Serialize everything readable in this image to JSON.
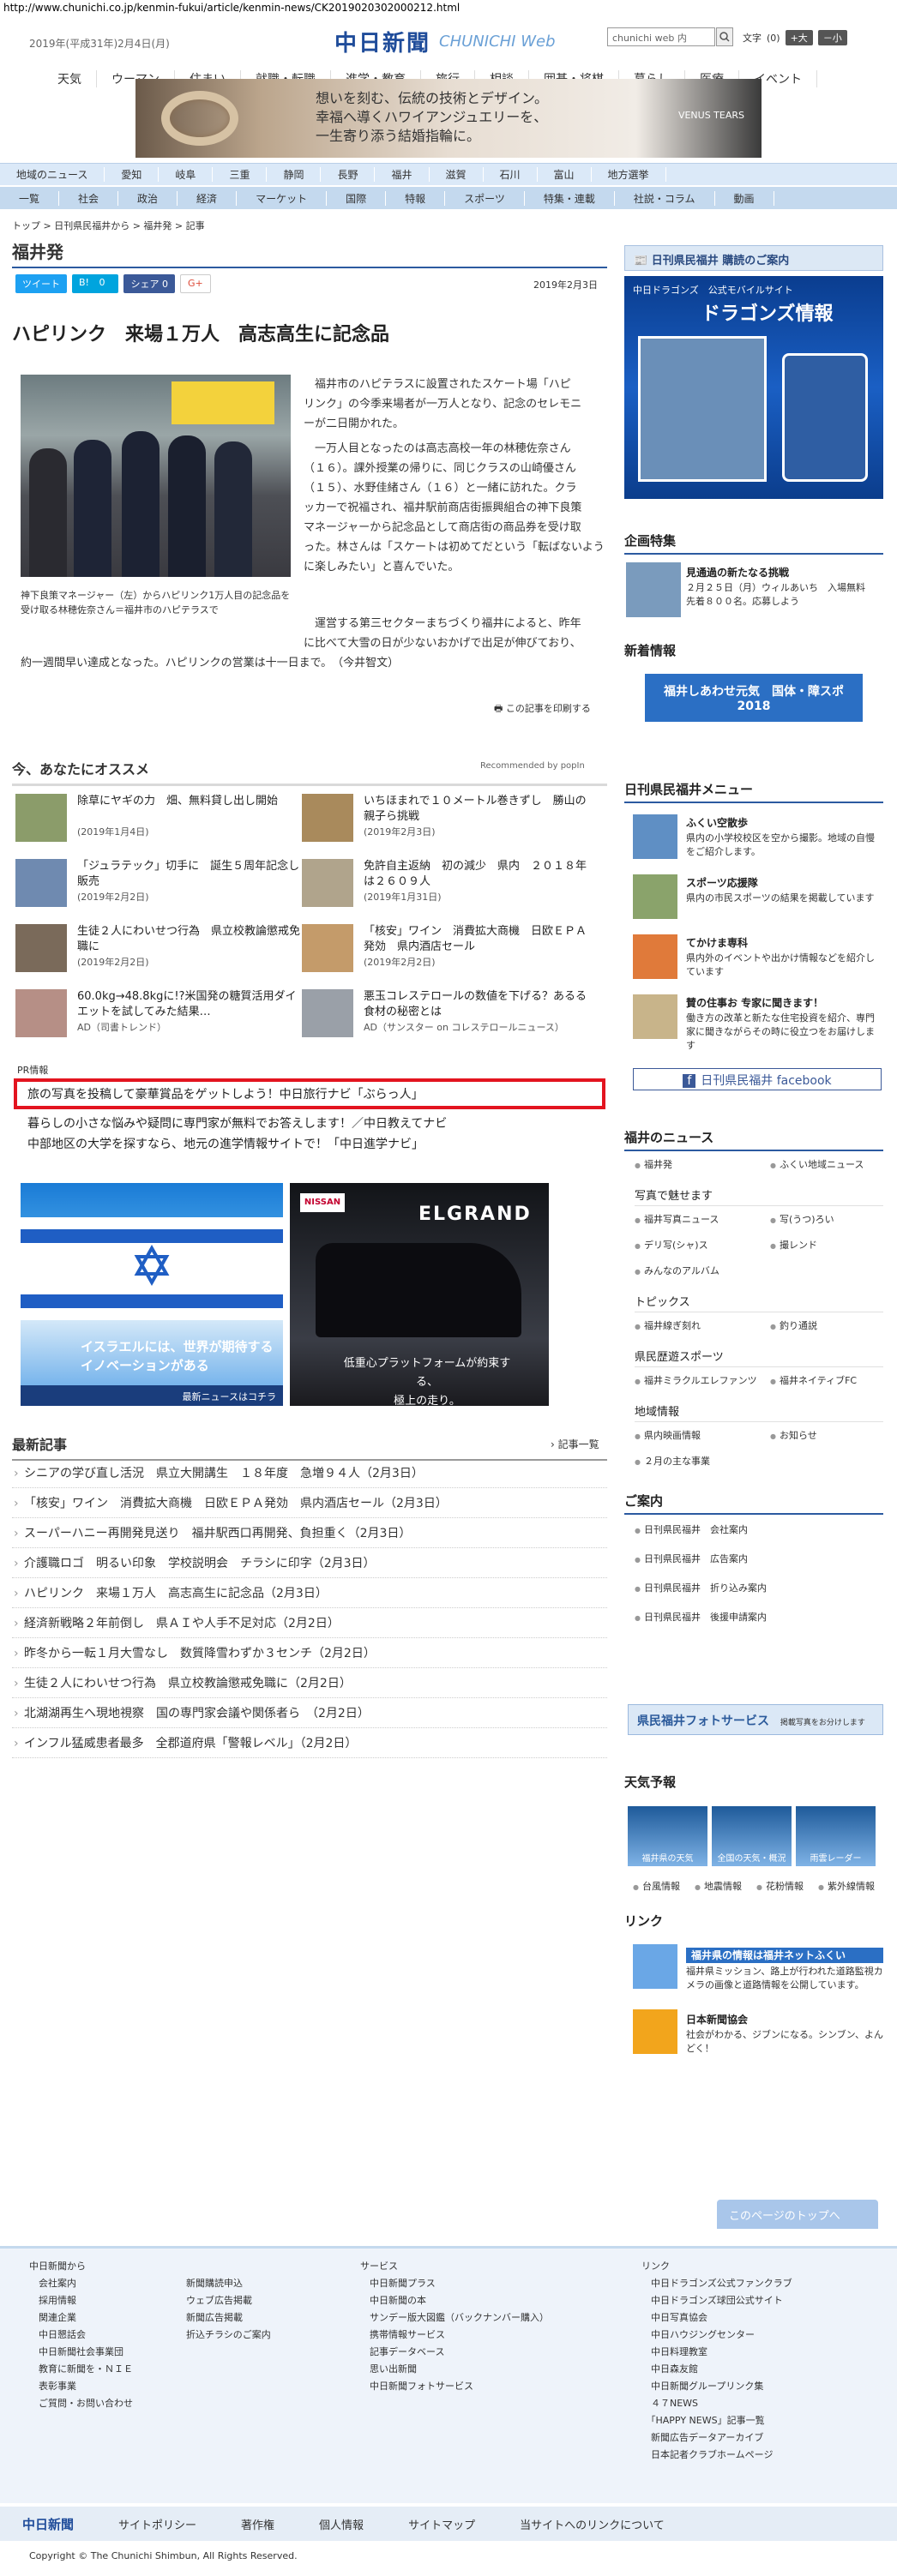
{
  "url": "http://www.chunichi.co.jp/kenmin-fukui/article/kenmin-news/CK2019020302000212.html",
  "header": {
    "date": "2019年(平成31年)2月4日(月)",
    "logo_jp": "中日新聞",
    "logo_en": "CHUNICHI Web",
    "search_placeholder": "chunichi web 内",
    "fontsize_label": "文字",
    "fontsize_value": "(0)",
    "fontsize_up": "+大",
    "fontsize_down": "－小"
  },
  "topnav": [
    "天気",
    "ウーマン",
    "住まい",
    "就職・転職",
    "進学・教育",
    "旅行",
    "相談",
    "囲碁・将棋",
    "暮らし",
    "医療",
    "イベント"
  ],
  "banner": {
    "line1": "想いを刻む、伝統の技術とデザイン。",
    "line2": "幸福へ導くハワイアンジュエリーを、",
    "line3": "一生寄り添う結婚指輪に。",
    "brand": "VENUS TEARS"
  },
  "regionbar": [
    "地域のニュース",
    "愛知",
    "岐阜",
    "三重",
    "静岡",
    "長野",
    "福井",
    "滋賀",
    "石川",
    "富山",
    "地方選挙"
  ],
  "catbar": [
    "一覧",
    "社会",
    "政治",
    "経済",
    "マーケット",
    "国際",
    "特報",
    "スポーツ",
    "特集・連載",
    "社説・コラム",
    "動画"
  ],
  "breadcrumb": "トップ > 日刊県民福井から > 福井発 > 記事",
  "section_title": "福井発",
  "social": {
    "tweet": "ツイート",
    "hatena": "0",
    "share": "シェア 0",
    "gplus": "G+"
  },
  "pubdate": "2019年2月3日",
  "headline": "ハピリンク　来場１万人　高志高生に記念品",
  "photo_caption": "神下良策マネージャー（左）からハピリンク1万人目の記念品を受け取る林穂佐奈さん＝福井市のハピテラスで",
  "body": {
    "p1a": "福井市のハピテラスに設置されたスケート場「ハピ",
    "p1b": "リンク」の今季来場者が一万人となり、記念のセレモニ",
    "p1c": "ーが二日開かれた。",
    "p2a": "一万人目となったのは高志高校一年の林穂佐奈さん",
    "p2b": "（１６）。課外授業の帰りに、同じクラスの山崎優さん",
    "p2c": "（１５）、水野佳緒さん（１６）と一緒に訪れた。クラ",
    "p2d": "ッカーで祝福され、福井駅前商店街振興組合の神下良策",
    "p2e": "マネージャーから記念品として商店街の商品券を受け取",
    "p2f": "った。林さんは「スケートは初めてだという「転ばないよう",
    "p2g": "に楽しみたい」と喜んでいた。",
    "p3a": "運営する第三セクターまちづくり福井によると、昨年",
    "p3b": "に比べて大雪の日が少ないおかげで出足が伸びており、",
    "p3c": "約一週間早い達成となった。ハピリンクの営業は十一日まで。　（今井智文）"
  },
  "print_label": "この記事を印刷する",
  "recommend": {
    "title": "今、あなたにオススメ",
    "by": "Recommended by popIn",
    "items": [
      {
        "title": "除草にヤギの力　畑、無料貸し出し開始",
        "date": "(2019年1月4日)"
      },
      {
        "title": "いちほまれで１０メートル巻きずし　勝山の親子ら挑戦",
        "date": "(2019年2月3日)"
      },
      {
        "title": "「ジュラテック」切手に　誕生５周年記念し販売",
        "date": "(2019年2月2日)"
      },
      {
        "title": "免許自主返納　初の減少　県内　２０１８年は２６０９人",
        "date": "(2019年1月31日)"
      },
      {
        "title": "生徒２人にわいせつ行為　県立校教論懲戒免職に",
        "date": "(2019年2月2日)"
      },
      {
        "title": "「核安」ワイン　消費拡大商機　日欧ＥＰＡ発効　県内酒店セール",
        "date": "(2019年2月2日)"
      },
      {
        "title": "60.0kg→48.8kgに!?米国発の糖質活用ダイエットを試してみた結果…",
        "date": "AD（司書トレンド）"
      },
      {
        "title": "悪玉コレステロールの数値を下げる？あるる食材の秘密とは",
        "date": "AD（サンスター on コレステロールニュース）"
      }
    ]
  },
  "pr": {
    "label": "PR情報",
    "l1": "旅の写真を投稿して豪華賞品をゲットしよう！中日旅行ナビ「ぶらっ人」",
    "l2": "暮らしの小さな悩みや疑問に専門家が無料でお答えします！／中日教えてナビ",
    "l3": "中部地区の大学を探すなら、地元の進学情報サイトで！「中日進学ナビ」"
  },
  "ads": {
    "a1_text": "イスラエルには、世界が期待するイノベーションがある",
    "a1_foot": "最新ニュースはコチラ",
    "a2_brand": "NISSAN",
    "a2_model": "ELGRAND",
    "a2_text1": "低重心プラットフォームが約束する、",
    "a2_text2": "極上の走り。"
  },
  "latest": {
    "title": "最新記事",
    "more": "記事一覧",
    "items": [
      "シニアの学び直し活況　県立大開講生　１８年度　急増９４人（2月3日）",
      "「核安」ワイン　消費拡大商機　日欧ＥＰＡ発効　県内酒店セール（2月3日）",
      "スーパーハニー再開発見送り　福井駅西口再開発、負担重く（2月3日）",
      "介護職ロゴ　明るい印象　学校説明会　チラシに印字（2月3日）",
      "ハピリンク　来場１万人　高志高生に記念品（2月3日）",
      "経済新戦略２年前倒し　県ＡＩや人手不足対応（2月2日）",
      "昨冬から一転１月大雪なし　数質降雪わずか３センチ（2月2日）",
      "生徒２人にわいせつ行為　県立校教論懲戒免職に（2月2日）",
      "北湖湖再生へ現地視察　国の専門家会議や関係者ら　（2月2日）",
      "インフル猛威患者最多　全郡道府県「警報レベル」（2月2日）"
    ]
  },
  "sidebar": {
    "subscribe": "日刊県民福井 購読のご案内",
    "dragons_title": "中日ドラゴンズ　公式モバイルサイト",
    "dragons_name": "ドラゴンズ情報",
    "kikaku_title": "企画特集",
    "kikaku_item_title": "見通過の新たなる挑戦",
    "kikaku_item_text": "２月２５日（月）ウィルあいち　入場無料　先着８００名。応募しよう",
    "new_title": "新着情報",
    "new_banner": "福井しあわせ元気　国体・障スポ 2018",
    "menu_title": "日刊県民福井メニュー",
    "menu": [
      {
        "title": "ふくい空散歩",
        "text": "県内の小学校校区を空から撮影。地域の自慢をご紹介します。"
      },
      {
        "title": "スポーツ応援隊",
        "text": "県内の市民スポーツの結果を掲載しています"
      },
      {
        "title": "てかけま専科",
        "text": "県内外のイベントや出かけ情報などを紹介しています"
      },
      {
        "title": "賛の住事お 专家に聞きます！",
        "text": "働き方の改革と新たな住宅投資を紹介、専門家に聞きながらその時に役立つをお届けします"
      }
    ],
    "facebook": "日刊県民福井 facebook",
    "fukui_news_title": "福井のニュース",
    "fukui_news": [
      "福井発",
      "ふくい地域ニュース"
    ],
    "photo_title": "写真で魅せます",
    "photo_links": [
      "福井写真ニュース",
      "写(うつ)ろい",
      "デリ写(シャ)ス",
      "撮レンド",
      "みんなのアルバム"
    ],
    "topics_title": "トピックス",
    "topics": [
      "福井線ぎ刻れ",
      "釣り通説"
    ],
    "sports_title": "県民歴遊スポーツ",
    "sports": [
      "福井ミラクルエレファンツ",
      "福井ネイティブFC"
    ],
    "local_title": "地域情報",
    "local": [
      "県内映画情報",
      "お知らせ",
      "２月の主な事業"
    ],
    "guide_title": "ご案内",
    "guide": [
      "日刊県民福井　会社案内",
      "日刊県民福井　広告案内",
      "日刊県民福井　折り込み案内",
      "日刊県民福井　後援申請案内"
    ],
    "photo_service": "県民福井フォトサービス",
    "photo_service_sub": "掲載写真をお分けします",
    "weather_title": "天気予報",
    "weather": [
      "福井県の天気",
      "全国の天気・概況",
      "雨雲レーダー"
    ],
    "weather_links": [
      "台風情報",
      "地震情報",
      "花粉情報",
      "紫外線情報"
    ],
    "links_title": "リンク",
    "link1": "福井県の情報は福井ネットふくい",
    "link1_text": "福井県ミッション、路上が行われた道路監視カメラの画像と道路情報を公開しています。",
    "link2": "日本新聞協会",
    "link2_text": "社会がわかる、ジブンになる。シンブン、よんどく！"
  },
  "totop": "このページのトップへ",
  "footer": {
    "col1_title": "中日新聞から",
    "col1": [
      "会社案内",
      "採用情報",
      "関連企業",
      "中日懇話会",
      "中日新聞社会事業団",
      "教育に新聞を・ＮＩＥ",
      "表彰事業",
      "ご質問・お問い合わせ"
    ],
    "col2": [
      "新聞購読申込",
      "ウェブ広告掲載",
      "新聞広告掲載",
      "折込チラシのご案内"
    ],
    "col3_title": "サービス",
    "col3": [
      "中日新聞プラス",
      "中日新聞の本",
      "サンデー版大図鑑（バックナンバー購入）",
      "携帯情報サービス",
      "記事データベース",
      "思い出新聞",
      "中日新聞フォトサービス"
    ],
    "col4_title": "リンク",
    "col4": [
      "中日ドラゴンズ公式ファンクラブ",
      "中日ドラゴンズ球団公式サイト",
      "中日写真協会",
      "中日ハウジングセンター",
      "中日料理教室",
      "中日森友館",
      "中日新聞グループリンク集",
      "４７NEWS",
      "「HAPPY NEWS」記事一覧",
      "新聞広告データアーカイブ",
      "日本記者クラブホームページ"
    ],
    "bar": [
      "中日新聞",
      "サイトポリシー",
      "著作権",
      "個人情報",
      "サイトマップ",
      "当サイトへのリンクについて"
    ],
    "copyright": "Copyright © The Chunichi Shimbun, All Rights Reserved."
  }
}
